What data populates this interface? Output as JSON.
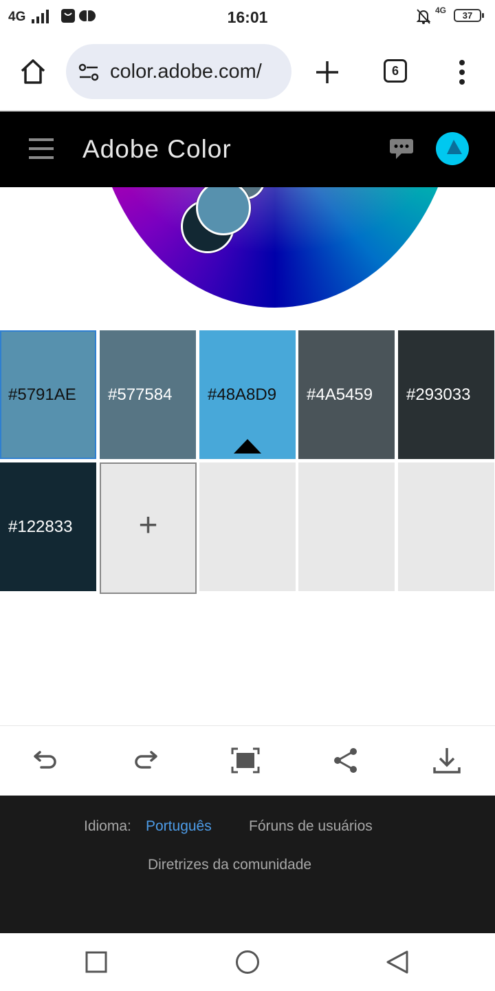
{
  "status_bar": {
    "network": "4G",
    "time": "16:01",
    "network_right": "4G",
    "battery": "37"
  },
  "browser": {
    "url": "color.adobe.com/",
    "tab_count": "6"
  },
  "app": {
    "title": "Adobe Color",
    "avatar_color": "#00c8f0"
  },
  "swatches": [
    {
      "hex": "#5791AE",
      "color": "#5791AE",
      "selected_outline": true
    },
    {
      "hex": "#577584",
      "color": "#577584"
    },
    {
      "hex": "#48A8D9",
      "color": "#48A8D9",
      "active": true
    },
    {
      "hex": "#4A5459",
      "color": "#4A5459"
    },
    {
      "hex": "#293033",
      "color": "#293033"
    },
    {
      "hex": "#122833",
      "color": "#122833"
    }
  ],
  "add_swatch_label": "+",
  "toolbar": [
    "undo-icon",
    "redo-icon",
    "fullscreen-icon",
    "share-icon",
    "download-icon"
  ],
  "footer": {
    "language_label": "Idioma:",
    "language_value": "Português",
    "forums": "Fóruns de usuários",
    "guidelines": "Diretrizes da comunidade"
  }
}
